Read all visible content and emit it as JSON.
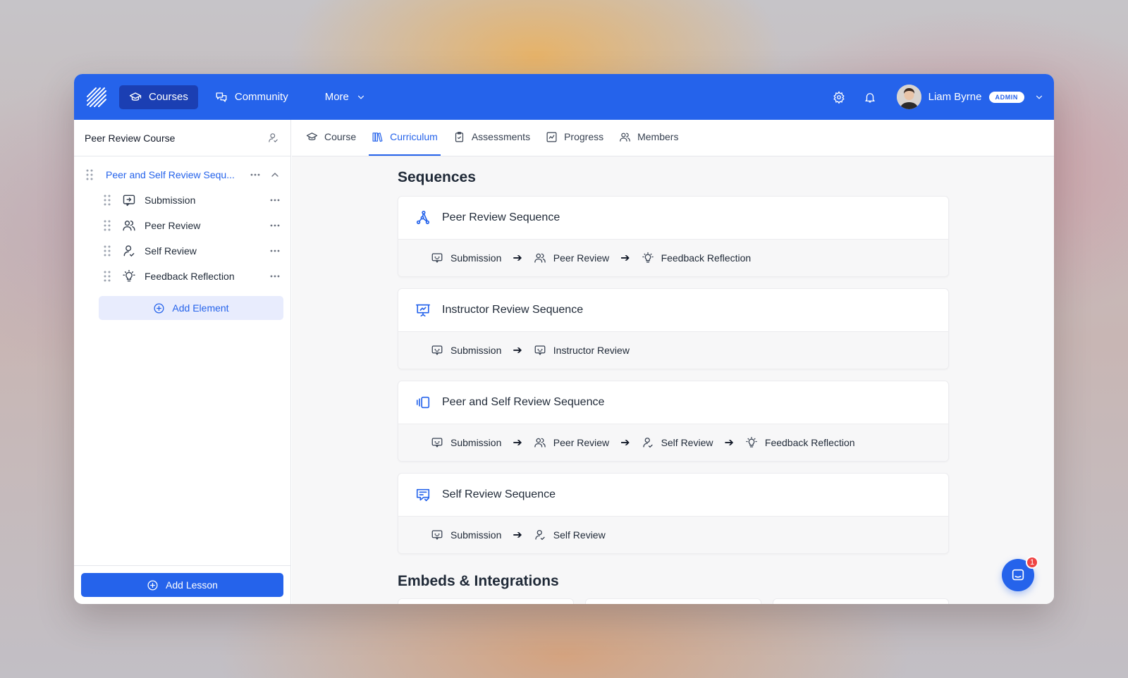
{
  "nav": {
    "logo_icon": "stripes-logo-icon",
    "items": [
      {
        "label": "Courses",
        "icon": "graduation-cap-icon",
        "active": true
      },
      {
        "label": "Community",
        "icon": "chat-bubbles-icon",
        "active": false
      },
      {
        "label": "More",
        "icon": "chevron-down-icon",
        "active": false
      }
    ],
    "user": {
      "name": "Liam Byrne",
      "role_badge": "ADMIN"
    },
    "colors": {
      "primary": "#2563eb",
      "active_nav": "#1b3fb3"
    }
  },
  "sidebar": {
    "course_title": "Peer Review Course",
    "lesson": {
      "title": "Peer and Self Review Sequ...",
      "elements": [
        {
          "label": "Submission",
          "icon": "submission-icon"
        },
        {
          "label": "Peer Review",
          "icon": "users-icon"
        },
        {
          "label": "Self Review",
          "icon": "user-check-icon"
        },
        {
          "label": "Feedback Reflection",
          "icon": "lightbulb-icon"
        }
      ]
    },
    "add_element_label": "Add Element",
    "add_lesson_label": "Add Lesson"
  },
  "tabs": [
    {
      "label": "Course",
      "icon": "graduation-cap-icon",
      "active": false
    },
    {
      "label": "Curriculum",
      "icon": "books-icon",
      "active": true
    },
    {
      "label": "Assessments",
      "icon": "clipboard-icon",
      "active": false
    },
    {
      "label": "Progress",
      "icon": "chart-icon",
      "active": false
    },
    {
      "label": "Members",
      "icon": "users-icon",
      "active": false
    }
  ],
  "main": {
    "sequences_title": "Sequences",
    "sequences": [
      {
        "name": "Peer Review Sequence",
        "icon": "network-icon",
        "steps": [
          {
            "label": "Submission",
            "icon": "chat-box-icon"
          },
          {
            "label": "Peer Review",
            "icon": "users-icon"
          },
          {
            "label": "Feedback Reflection",
            "icon": "lightbulb-icon"
          }
        ]
      },
      {
        "name": "Instructor Review Sequence",
        "icon": "presentation-icon",
        "steps": [
          {
            "label": "Submission",
            "icon": "chat-box-icon"
          },
          {
            "label": "Instructor Review",
            "icon": "chat-box-icon"
          }
        ]
      },
      {
        "name": "Peer and Self Review Sequence",
        "icon": "cards-icon",
        "steps": [
          {
            "label": "Submission",
            "icon": "chat-box-icon"
          },
          {
            "label": "Peer Review",
            "icon": "users-icon"
          },
          {
            "label": "Self Review",
            "icon": "user-check-icon"
          },
          {
            "label": "Feedback Reflection",
            "icon": "lightbulb-icon"
          }
        ]
      },
      {
        "name": "Self Review Sequence",
        "icon": "message-check-icon",
        "steps": [
          {
            "label": "Submission",
            "icon": "chat-box-icon"
          },
          {
            "label": "Self Review",
            "icon": "user-check-icon"
          }
        ]
      }
    ],
    "embeds_title": "Embeds & Integrations"
  },
  "chat": {
    "unread_count": "1",
    "icon": "chat-launcher-icon"
  }
}
